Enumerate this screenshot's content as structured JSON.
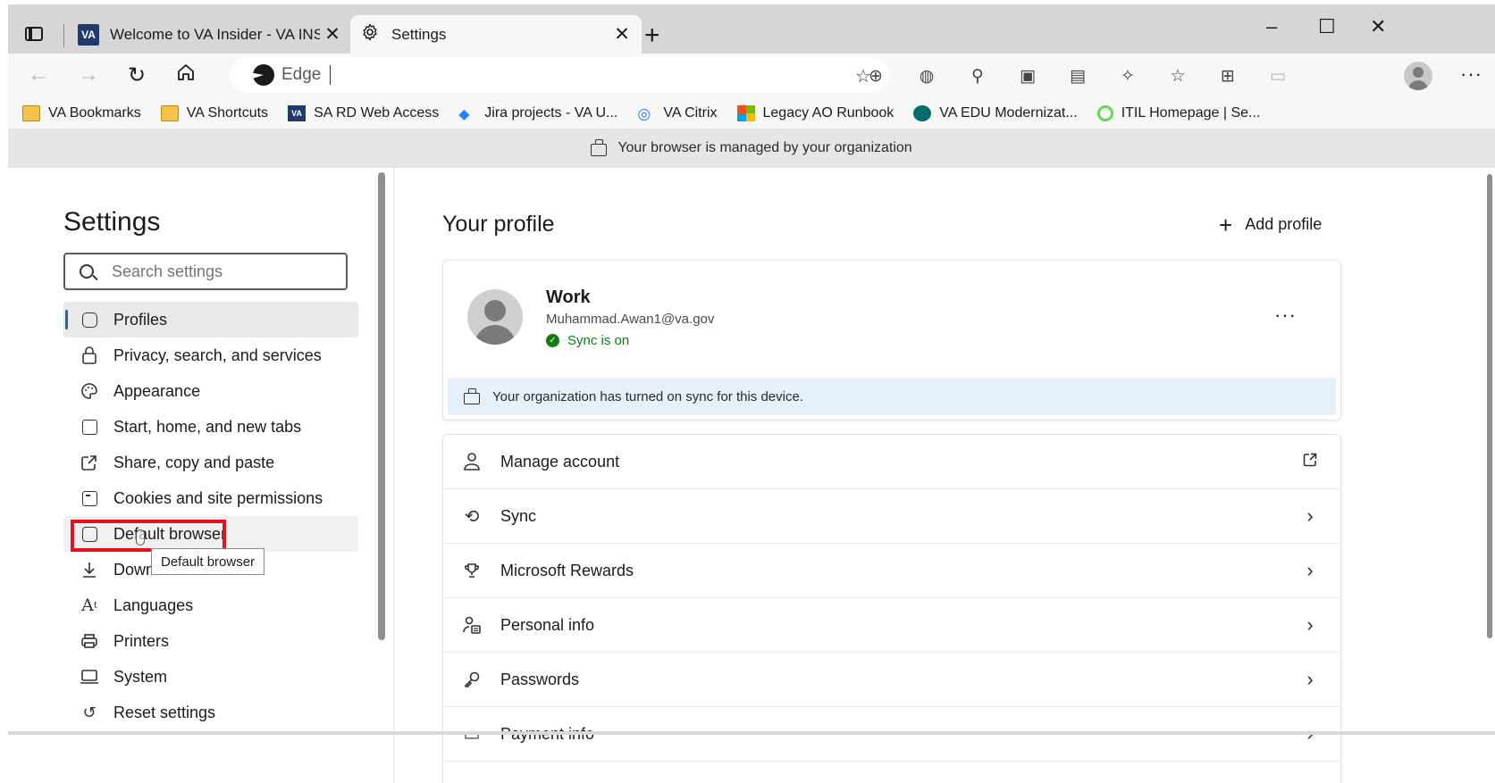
{
  "tabs": [
    {
      "title": "Welcome to VA Insider - VA INSIDER",
      "logo": "VA",
      "active": false
    },
    {
      "title": "Settings",
      "icon": "gear-icon",
      "active": true
    }
  ],
  "window_controls": {
    "minimize": "–",
    "maximize": "☐",
    "close": "✕"
  },
  "toolbar": {
    "address_text": "Edge",
    "address_icon": "edge-logo-icon"
  },
  "favorites": [
    {
      "label": "VA Bookmarks",
      "icon": "folder-icon"
    },
    {
      "label": "VA Shortcuts",
      "icon": "folder-icon"
    },
    {
      "label": "SA RD Web Access",
      "icon": "va-logo-icon"
    },
    {
      "label": "Jira projects - VA U...",
      "icon": "jira-icon"
    },
    {
      "label": "VA Citrix",
      "icon": "citrix-icon"
    },
    {
      "label": "Legacy AO Runbook",
      "icon": "microsoft-icon"
    },
    {
      "label": "VA EDU Modernizat...",
      "icon": "sharepoint-icon"
    },
    {
      "label": "ITIL Homepage | Se...",
      "icon": "servicenow-icon"
    }
  ],
  "managed_notice": "Your browser is managed by your organization",
  "sidebar": {
    "title": "Settings",
    "search_placeholder": "Search settings",
    "items": [
      {
        "label": "Profiles",
        "icon": "profiles-icon",
        "selected": true
      },
      {
        "label": "Privacy, search, and services",
        "icon": "lock-icon"
      },
      {
        "label": "Appearance",
        "icon": "palette-icon"
      },
      {
        "label": "Start, home, and new tabs",
        "icon": "home-tabs-icon"
      },
      {
        "label": "Share, copy and paste",
        "icon": "share-icon"
      },
      {
        "label": "Cookies and site permissions",
        "icon": "cookies-icon"
      },
      {
        "label": "Default browser",
        "icon": "default-browser-icon",
        "hovered": true
      },
      {
        "label": "Downloads",
        "icon": "download-icon"
      },
      {
        "label": "Languages",
        "icon": "languages-icon"
      },
      {
        "label": "Printers",
        "icon": "printer-icon"
      },
      {
        "label": "System",
        "icon": "laptop-icon"
      },
      {
        "label": "Reset settings",
        "icon": "reset-icon"
      }
    ],
    "tooltip": "Default browser"
  },
  "main": {
    "title": "Your profile",
    "add_profile_label": "Add profile",
    "profile": {
      "name": "Work",
      "email": "Muhammad.Awan1@va.gov",
      "sync_status": "Sync is on",
      "org_banner": "Your organization has turned on sync for this device."
    },
    "menu": [
      {
        "label": "Manage account",
        "icon": "person-icon",
        "trailing": "external-link-icon"
      },
      {
        "label": "Sync",
        "icon": "sync-icon",
        "trailing": "chevron-right-icon"
      },
      {
        "label": "Microsoft Rewards",
        "icon": "trophy-icon",
        "trailing": "chevron-right-icon"
      },
      {
        "label": "Personal info",
        "icon": "personal-info-icon",
        "trailing": "chevron-right-icon"
      },
      {
        "label": "Passwords",
        "icon": "key-icon",
        "trailing": "chevron-right-icon"
      },
      {
        "label": "Payment info",
        "icon": "card-icon",
        "trailing": "chevron-right-icon"
      }
    ]
  },
  "colors": {
    "accent": "#0f6cbd",
    "highlight_box": "#e8121d",
    "sync_green": "#107c10",
    "banner_bg": "#e6f0f9"
  }
}
